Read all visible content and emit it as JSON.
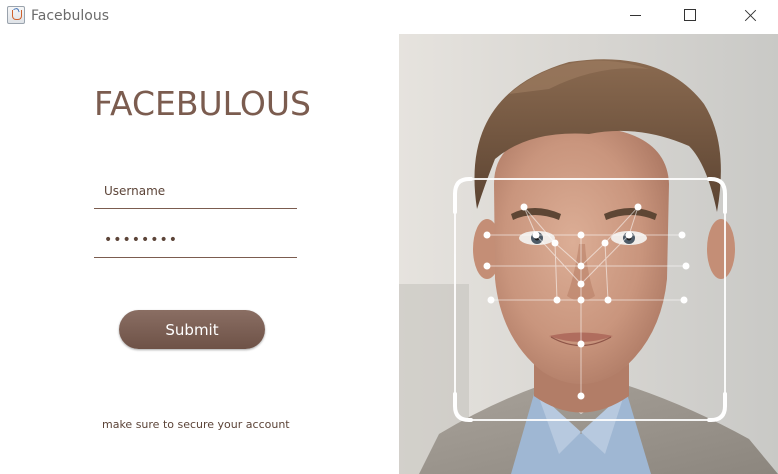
{
  "window": {
    "title": "Facebulous",
    "icon": "java-cup-icon",
    "controls": [
      "minimize-icon",
      "maximize-icon",
      "close-icon"
    ]
  },
  "login": {
    "brand": "FACEBULOUS",
    "username_placeholder": "Username",
    "password_value": "••••••••",
    "submit_label": "Submit",
    "tagline": "make sure to secure your account"
  },
  "colors": {
    "brand": "#7b5c4f",
    "button": "#7b5e52",
    "text": "#5c4438"
  }
}
